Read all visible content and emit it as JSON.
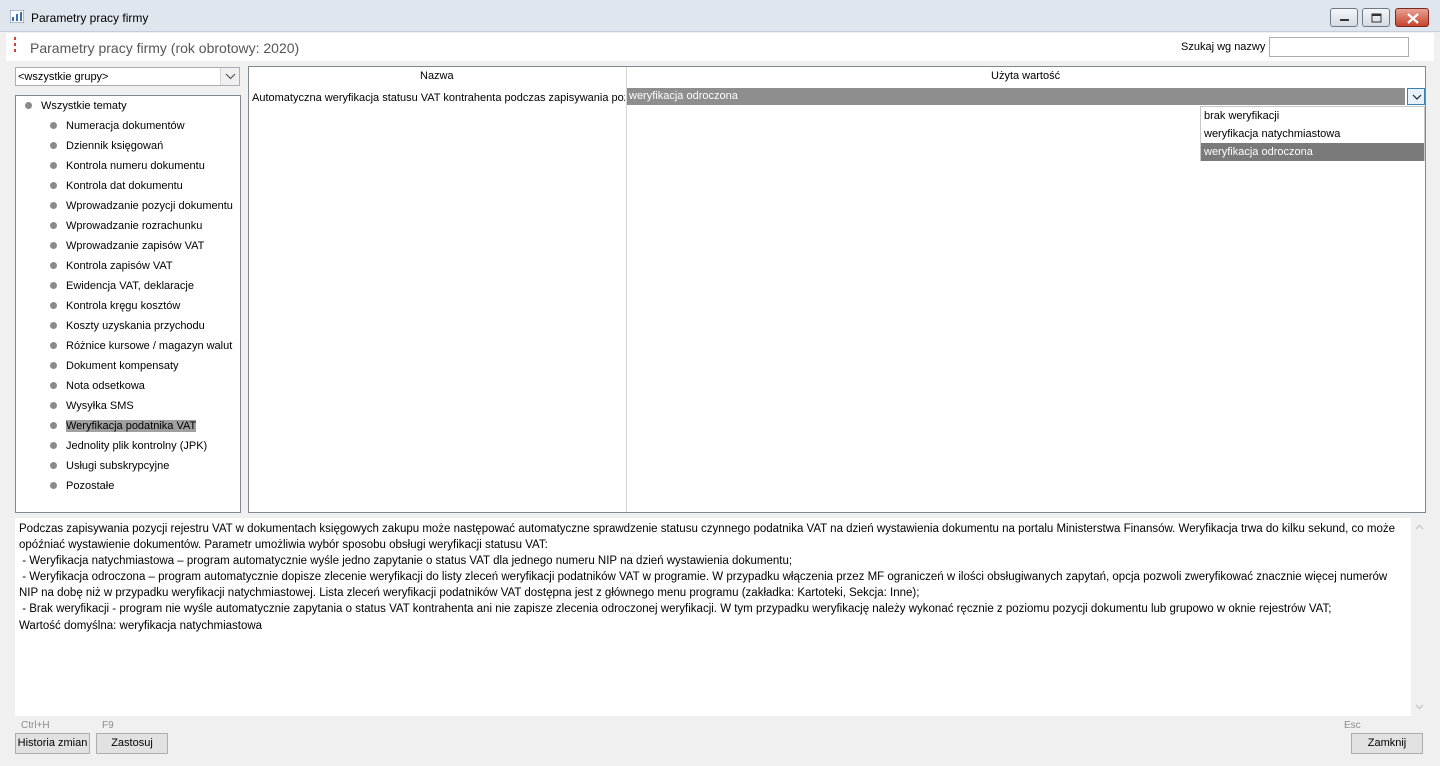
{
  "window": {
    "title": "Parametry pracy firmy"
  },
  "header": {
    "title": "Parametry pracy firmy (rok obrotowy: 2020)",
    "search_label": "Szukaj wg nazwy",
    "search_value": ""
  },
  "group_select": {
    "value": "<wszystkie grupy>"
  },
  "tree": {
    "root": "Wszystkie tematy",
    "items": [
      "Numeracja dokumentów",
      "Dziennik księgowań",
      "Kontrola numeru dokumentu",
      "Kontrola dat dokumentu",
      "Wprowadzanie pozycji dokumentu",
      "Wprowadzanie rozrachunku",
      "Wprowadzanie zapisów VAT",
      "Kontrola zapisów VAT",
      "Ewidencja VAT, deklaracje",
      "Kontrola kręgu kosztów",
      "Koszty uzyskania przychodu",
      "Różnice kursowe / magazyn walut",
      "Dokument kompensaty",
      "Nota odsetkowa",
      "Wysyłka SMS",
      "Weryfikacja podatnika VAT",
      "Jednolity plik kontrolny (JPK)",
      "Usługi subskrypcyjne",
      "Pozostałe"
    ],
    "selected": "Weryfikacja podatnika VAT"
  },
  "grid": {
    "col_name": "Nazwa",
    "col_value": "Użyta wartość",
    "row": {
      "name": "Automatyczna weryfikacja statusu VAT kontrahenta podczas zapisywania pozycji",
      "value": "weryfikacja odroczona"
    },
    "options": [
      "brak weryfikacji",
      "weryfikacja natychmiastowa",
      "weryfikacja odroczona"
    ],
    "selected_option": "weryfikacja odroczona"
  },
  "description": "Podczas zapisywania pozycji rejestru VAT w dokumentach księgowych zakupu może następować automatyczne sprawdzenie statusu czynnego podatnika VAT na dzień wystawienia dokumentu na portalu Ministerstwa Finansów. Weryfikacja trwa do kilku sekund, co może opóźniać wystawienie dokumentów. Parametr umożliwia wybór sposobu obsługi weryfikacji statusu VAT:\n - Weryfikacja natychmiastowa – program automatycznie wyśle jedno zapytanie o status VAT dla jednego numeru NIP na dzień wystawienia dokumentu;\n - Weryfikacja odroczona – program automatycznie dopisze zlecenie weryfikacji do listy zleceń weryfikacji podatników VAT w programie. W przypadku włączenia przez MF ograniczeń w ilości obsługiwanych zapytań, opcja pozwoli zweryfikować znacznie więcej numerów NIP na dobę niż w przypadku weryfikacji natychmiastowej. Lista zleceń weryfikacji podatników VAT dostępna jest z głównego menu programu (zakładka: Kartoteki, Sekcja: Inne);\n - Brak weryfikacji - program nie wyśle automatycznie zapytania o status VAT kontrahenta ani nie zapisze zlecenia odroczonej weryfikacji. W tym przypadku weryfikację należy wykonać ręcznie z poziomu pozycji dokumentu lub grupowo w oknie rejestrów VAT;\nWartość domyślna: weryfikacja natychmiastowa",
  "footer": {
    "history_key": "Ctrl+H",
    "history_label": "Historia zmian",
    "apply_key": "F9",
    "apply_label": "Zastosuj",
    "close_key": "Esc",
    "close_label": "Zamknij"
  },
  "colors": {
    "selection": "#a0a0a0",
    "value_bg": "#8e8e8e",
    "title_text": "#565656"
  }
}
